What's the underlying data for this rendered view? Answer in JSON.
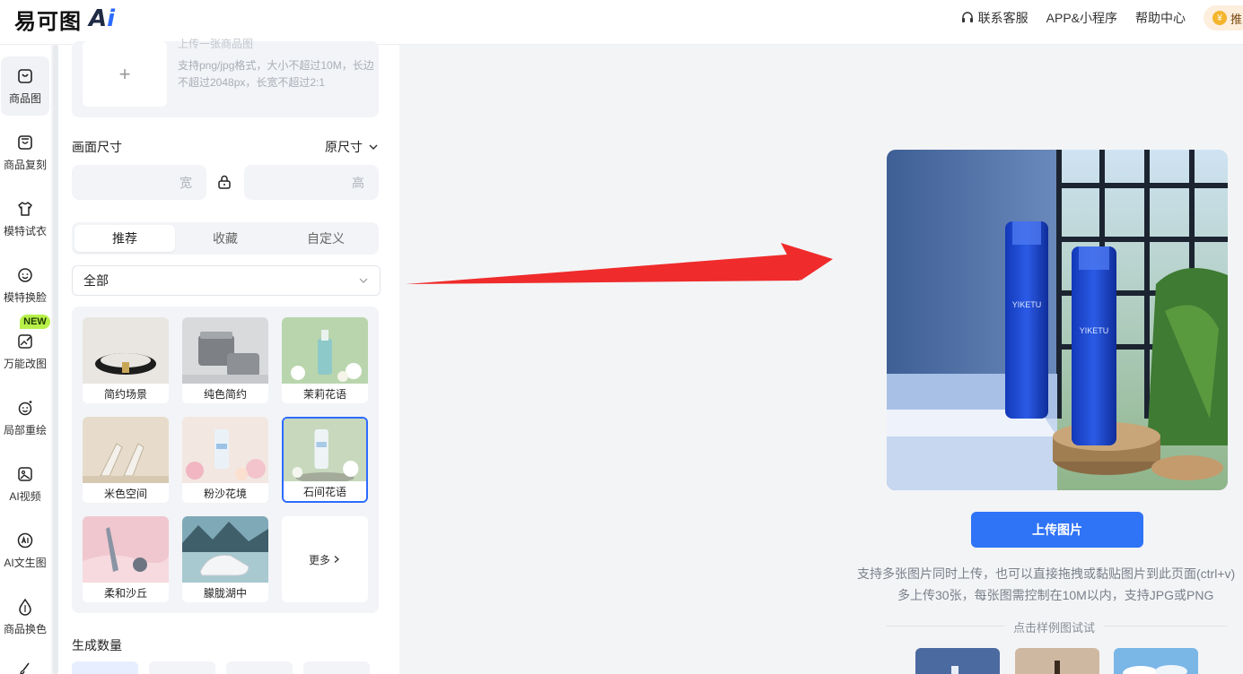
{
  "header": {
    "logo_text": "易可图",
    "logo_ai_a": "A",
    "logo_ai_i": "i",
    "nav": {
      "support": "联系客服",
      "app": "APP&小程序",
      "help": "帮助中心",
      "promo": "推"
    }
  },
  "rail": {
    "items": [
      {
        "label": "商品图",
        "icon": "bag-icon"
      },
      {
        "label": "商品复刻",
        "icon": "bag-copy-icon"
      },
      {
        "label": "模特试衣",
        "icon": "tshirt-icon"
      },
      {
        "label": "模特换脸",
        "icon": "face-icon"
      },
      {
        "label": "万能改图",
        "icon": "edit-image-icon"
      },
      {
        "label": "局部重绘",
        "icon": "face-sparkle-icon"
      },
      {
        "label": "AI视频",
        "icon": "video-icon"
      },
      {
        "label": "AI文生图",
        "icon": "ai-text-icon"
      },
      {
        "label": "商品换色",
        "icon": "drop-icon"
      }
    ],
    "badge": "NEW"
  },
  "panel": {
    "upload_cut_text": "上传一张商品图",
    "upload_hint": "支持png/jpg格式，大小不超过10M，长边不超过2048px，长宽不超过2:1",
    "size_label": "画面尺寸",
    "size_select": "原尺寸",
    "width_placeholder": "宽",
    "height_placeholder": "高",
    "tabs": [
      "推荐",
      "收藏",
      "自定义"
    ],
    "filter_value": "全部",
    "scenes": [
      "简约场景",
      "纯色简约",
      "茉莉花语",
      "米色空间",
      "粉沙花境",
      "石间花语",
      "柔和沙丘",
      "朦胧湖中"
    ],
    "more_label": "更多",
    "count_label": "生成数量"
  },
  "main": {
    "product_brand": "YIKETU",
    "upload_button": "上传图片",
    "hint_line1": "支持多张图片同时上传，也可以直接拖拽或黏贴图片到此页面(ctrl+v)",
    "hint_line2": "多上传30张，每张图需控制在10M以内，支持JPG或PNG",
    "sample_label": "点击样例图试试"
  },
  "colors": {
    "accent": "#2f73f6",
    "arrow": "#ef2b2b",
    "badge": "#b8f04a"
  }
}
